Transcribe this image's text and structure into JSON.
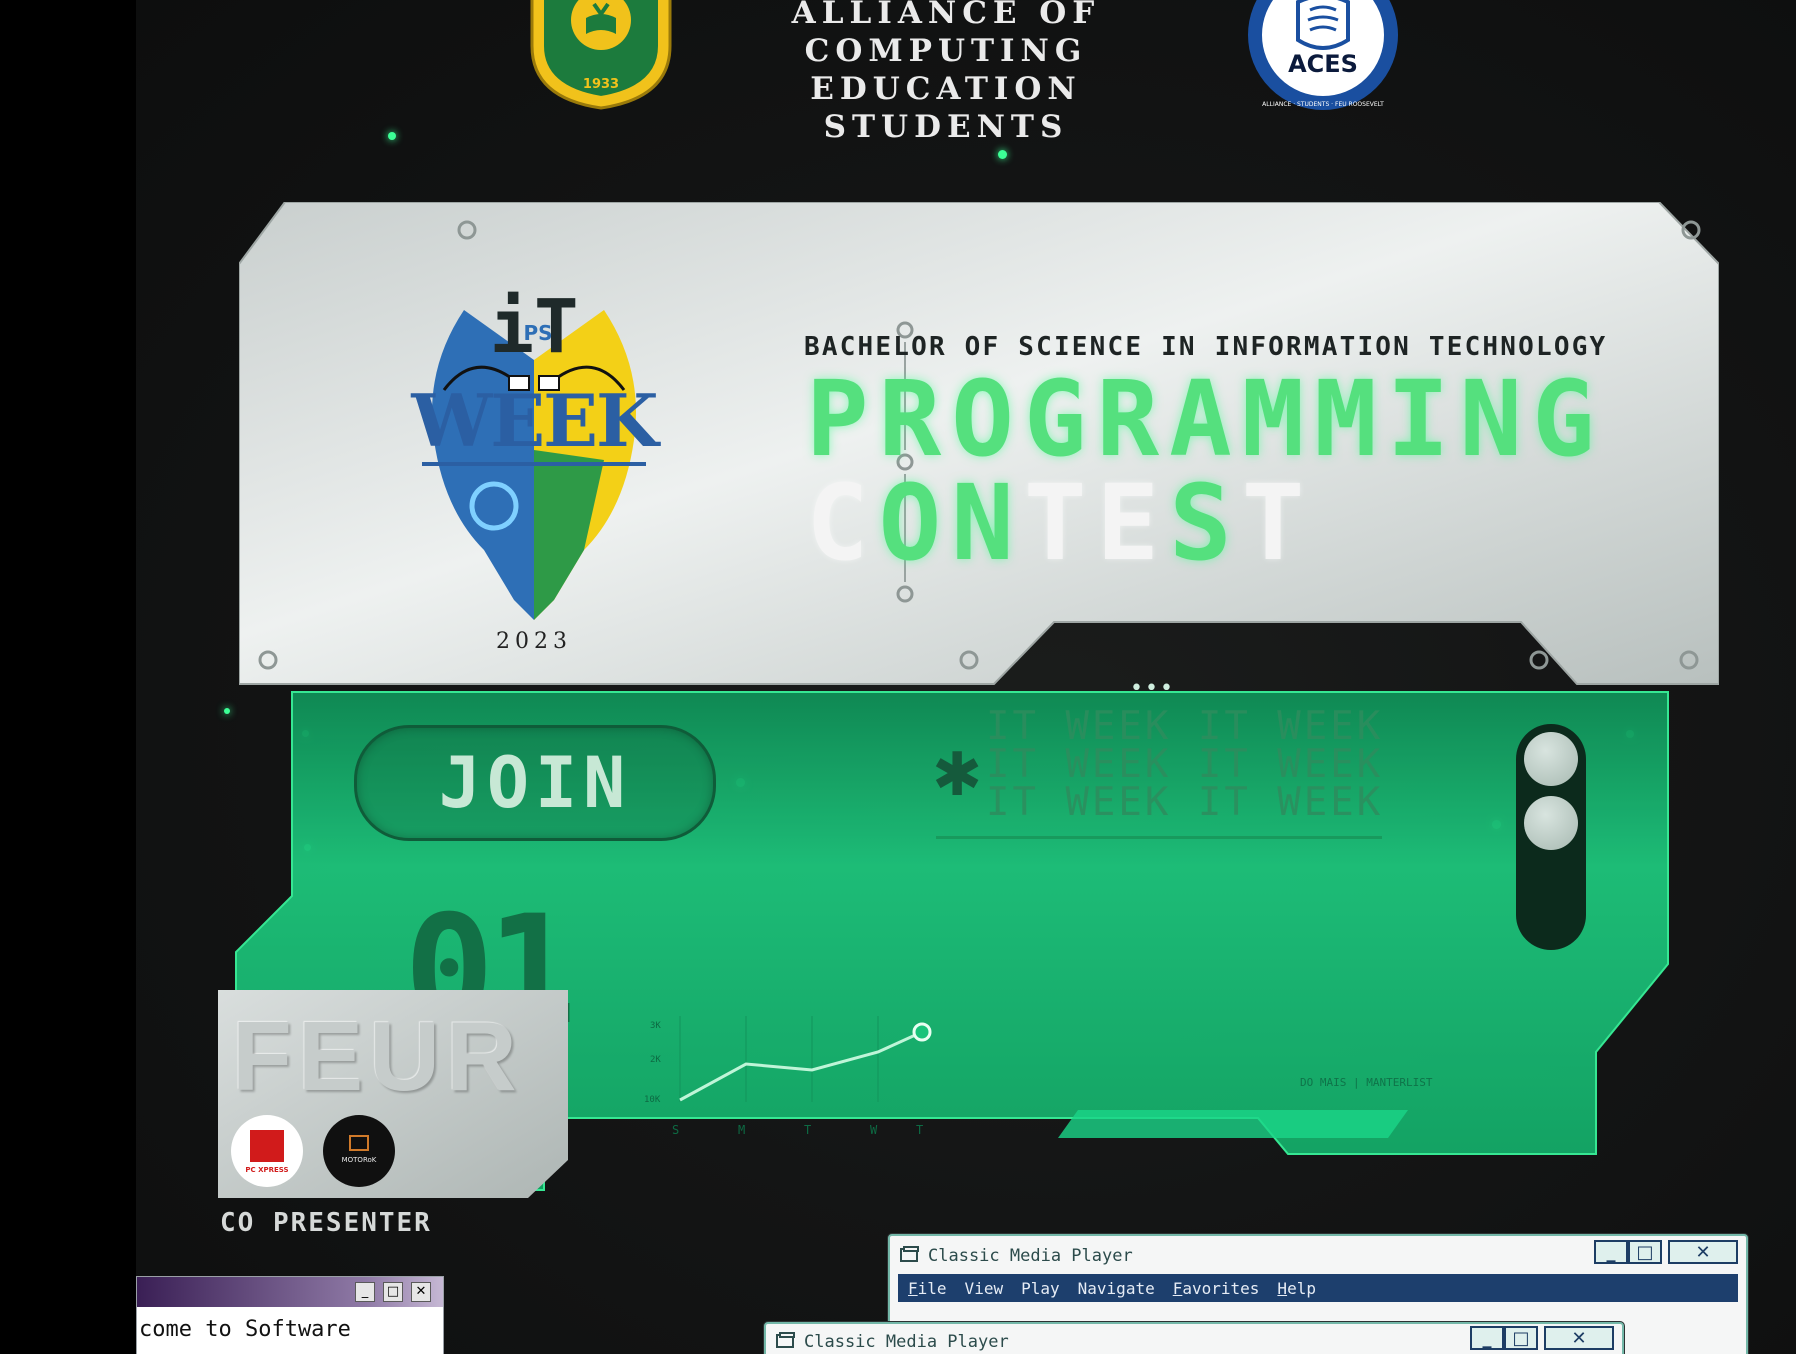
{
  "header": {
    "org_line_1": "ALLIANCE OF COMPUTING",
    "org_line_2": "EDUCATION STUDENTS",
    "feu_seal_year": "1933",
    "aces_logo_text": "ACES",
    "aces_ring_text": "ALLIANCE · STUDENTS · FEU ROOSEVELT"
  },
  "logo": {
    "name": "IT WEEK",
    "top": "iT",
    "mid": "PS",
    "word": "WEEK",
    "year": "2023"
  },
  "hero": {
    "subtitle": "BACHELOR OF SCIENCE IN INFORMATION TECHNOLOGY",
    "title_line_1": "PROGRAMMING",
    "title_line_2_a": "C",
    "title_line_2_b": "ON",
    "title_line_2_c": "TE",
    "title_line_2_d": "S",
    "title_line_2_e": "T"
  },
  "panel": {
    "join_label": "JOIN",
    "ticker": [
      "IT WEEK IT WEEK",
      "IT WEEK IT WEEK",
      "IT WEEK IT WEEK"
    ],
    "ticker_dots": "•••",
    "big_number": "01",
    "chart_labels": [
      "S",
      "M",
      "T",
      "W",
      "T"
    ],
    "chart_y_labels": [
      "3K",
      "2K",
      "10K"
    ],
    "corner_caption": "DO MAIS | MANTERLIST"
  },
  "co_presenters": {
    "card_text": "FEUR",
    "label": "CO PRESENTER",
    "sponsor_1": "PC XPRESS",
    "sponsor_2": "MOTORoK"
  },
  "windows": {
    "media_player_title": "Classic Media Player",
    "menu": [
      {
        "pre": "",
        "u": "F",
        "post": "ile"
      },
      {
        "pre": "",
        "u": "V",
        "post": "iew"
      },
      {
        "pre": "",
        "u": "P",
        "post": "lay"
      },
      {
        "pre": "",
        "u": "N",
        "post": "avigate"
      },
      {
        "pre": "",
        "u": "F",
        "post": "avorites"
      },
      {
        "pre": "",
        "u": "H",
        "post": "elp"
      }
    ],
    "old_window_text": "come to Software",
    "btn_min": "_",
    "btn_max": "□",
    "btn_close": "✕"
  },
  "colors": {
    "accent_green": "#55e07e",
    "panel_green": "#19c37a",
    "silver": "#d4d8d7",
    "menubar_blue": "#1d3f6d"
  }
}
